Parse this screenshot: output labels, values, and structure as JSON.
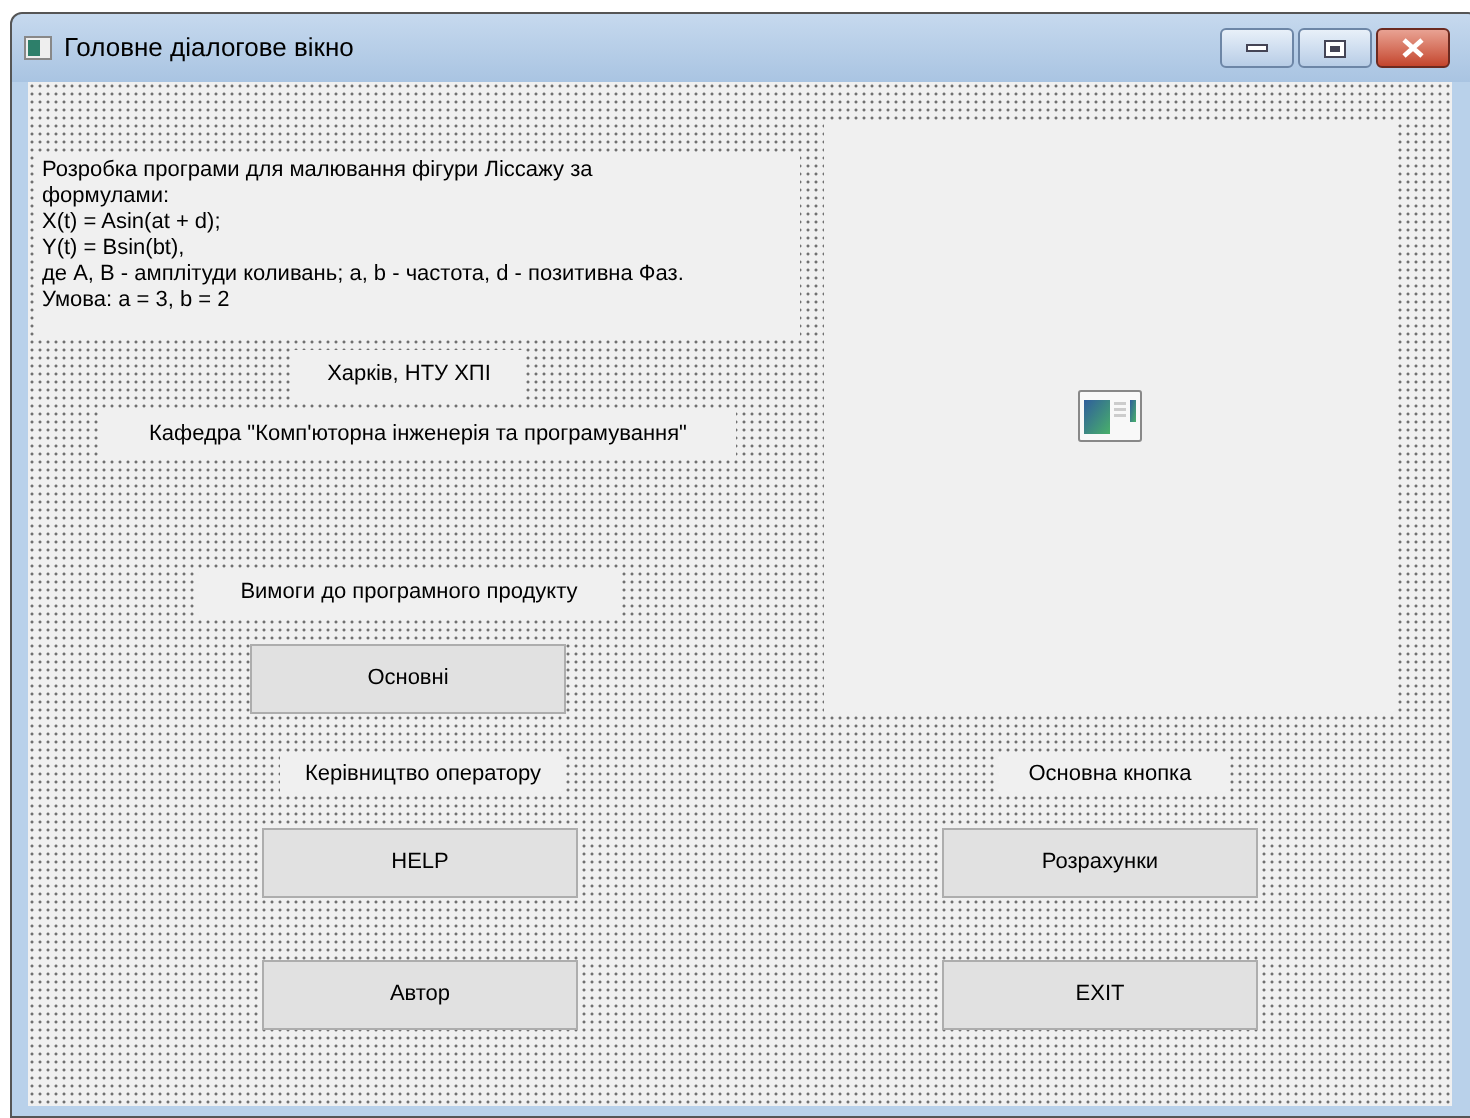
{
  "window": {
    "title": "Головне діалогове вікно"
  },
  "description_label": {
    "lines": [
      "Розробка програми для малювання фігури Ліссажу за",
      "формулами:",
      "X(t) = Asin(at + d);",
      "Y(t) = Bsin(bt),",
      "де A, B - амплітуди коливань; a, b - частота, d - позитивна Фаз.",
      "Умова: a = 3, b = 2"
    ]
  },
  "labels": [
    "Харків, НТУ ХПІ",
    "Кафедра \"Комп'юторна інженерія та програмування\"",
    "Вимоги до програмного продукту",
    "Керівництво оператору",
    "Основна кнопка"
  ],
  "buttons": [
    "Основні",
    "HELP",
    "Розрахунки",
    "Автор",
    "EXIT"
  ]
}
